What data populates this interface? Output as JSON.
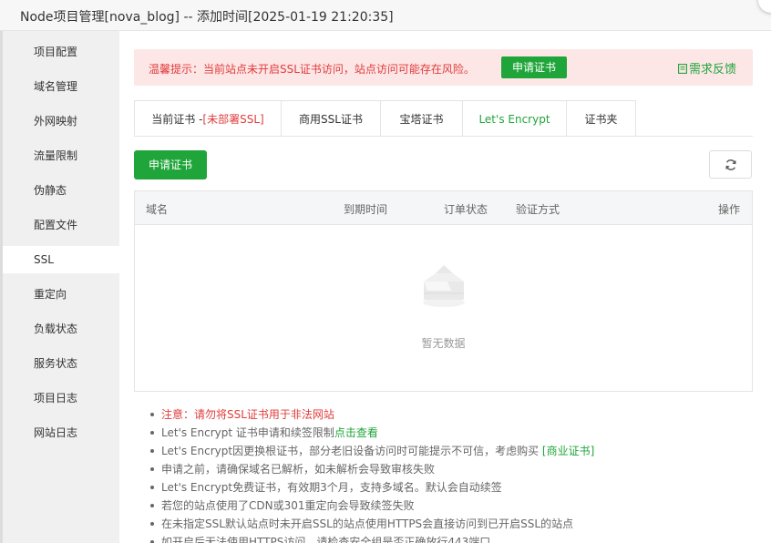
{
  "window": {
    "title": "Node项目管理[nova_blog] -- 添加时间[2025-01-19 21:20:35]"
  },
  "sidebar": {
    "items": [
      {
        "label": "项目配置"
      },
      {
        "label": "域名管理"
      },
      {
        "label": "外网映射"
      },
      {
        "label": "流量限制"
      },
      {
        "label": "伪静态"
      },
      {
        "label": "配置文件"
      },
      {
        "label": "SSL",
        "active": true
      },
      {
        "label": "重定向"
      },
      {
        "label": "负载状态"
      },
      {
        "label": "服务状态"
      },
      {
        "label": "项目日志"
      },
      {
        "label": "网站日志"
      }
    ]
  },
  "alert": {
    "text": "温馨提示：当前站点未开启SSL证书访问，站点访问可能存在风险。",
    "button": "申请证书",
    "feedback": "需求反馈"
  },
  "tabs": {
    "current_prefix": "当前证书 -",
    "current_status": "[未部署SSL]",
    "commercial": "商用SSL证书",
    "baota": "宝塔证书",
    "letsencrypt": "Let's Encrypt",
    "folder": "证书夹"
  },
  "toolbar": {
    "apply": "申请证书",
    "refresh_icon": "refresh-icon"
  },
  "table": {
    "headers": [
      "域名",
      "到期时间",
      "订单状态",
      "验证方式",
      "操作"
    ],
    "empty_text": "暂无数据"
  },
  "notes": {
    "n1": "注意：请勿将SSL证书用于非法网站",
    "n2_text": "Let's Encrypt 证书申请和续签限制",
    "n2_link": "点击查看",
    "n3_text": "Let's Encrypt因更换根证书，部分老旧设备访问时可能提示不可信，考虑购买 ",
    "n3_link": "[商业证书]",
    "n4": "申请之前，请确保域名已解析，如未解析会导致审核失败",
    "n5": "Let's Encrypt免费证书，有效期3个月，支持多域名。默认会自动续签",
    "n6": "若您的站点使用了CDN或301重定向会导致续签失败",
    "n7": "在未指定SSL默认站点时未开启SSL的站点使用HTTPS会直接访问到已开启SSL的站点",
    "n8": "如开启后无法使用HTTPS访问，请检查安全组是否正确放行443端口"
  },
  "colors": {
    "accent": "#20a53a",
    "danger": "#e03c3c",
    "alert_bg": "#fde6e6"
  }
}
